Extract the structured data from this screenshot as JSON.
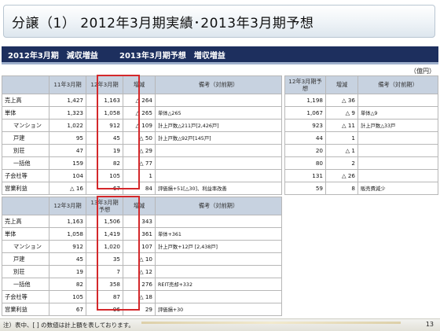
{
  "title": "分譲（1） 2012年3月期実績･2013年3月期予想",
  "section": {
    "left_label": "2012年3月期　減収増益",
    "right_label": "2013年3月期予想　増収増益"
  },
  "unit": "（億円）",
  "tables": {
    "top_left": {
      "headers": [
        "",
        "11年3月期",
        "12年3月期",
        "増減",
        "備考（対前期）"
      ],
      "rows": [
        [
          "売上高",
          "1,427",
          "1,163",
          "△ 264",
          ""
        ],
        [
          "単体",
          "1,323",
          "1,058",
          "△ 265",
          "単体△265"
        ],
        [
          "マンション",
          "1,022",
          "912",
          "△ 109",
          "計上戸数△211戸[2,426戸]"
        ],
        [
          "戸建",
          "95",
          "45",
          "△ 50",
          "計上戸数△92戸[145戸]"
        ],
        [
          "別荘",
          "47",
          "19",
          "△ 29",
          ""
        ],
        [
          "一括他",
          "159",
          "82",
          "△ 77",
          ""
        ],
        [
          "子会社等",
          "104",
          "105",
          "1",
          ""
        ],
        [
          "営業利益",
          "△ 16",
          "67",
          "84",
          "評価損+51[△30]、利益率改善"
        ]
      ]
    },
    "top_right": {
      "headers": [
        "12年3月期予想",
        "増減",
        "備考（対前期）"
      ],
      "rows": [
        [
          "1,198",
          "△ 36",
          ""
        ],
        [
          "1,067",
          "△ 9",
          "単体△9"
        ],
        [
          "923",
          "△ 11",
          "計上戸数△33戸"
        ],
        [
          "44",
          "1",
          ""
        ],
        [
          "20",
          "△ 1",
          ""
        ],
        [
          "80",
          "2",
          ""
        ],
        [
          "131",
          "△ 26",
          ""
        ],
        [
          "59",
          "8",
          "販売費減少"
        ]
      ]
    },
    "bottom_left": {
      "headers": [
        "",
        "12年3月期",
        "13年3月期予想",
        "増減",
        "備考（対前期）"
      ],
      "rows": [
        [
          "売上高",
          "1,163",
          "1,506",
          "343",
          ""
        ],
        [
          "単体",
          "1,058",
          "1,419",
          "361",
          "単体+361"
        ],
        [
          "マンション",
          "912",
          "1,020",
          "107",
          "計上戸数+12戸 [2,438戸]"
        ],
        [
          "戸建",
          "45",
          "35",
          "△ 10",
          ""
        ],
        [
          "別荘",
          "19",
          "7",
          "△ 12",
          ""
        ],
        [
          "一括他",
          "82",
          "358",
          "276",
          "REIT売却+332"
        ],
        [
          "子会社等",
          "105",
          "87",
          "△ 18",
          ""
        ],
        [
          "営業利益",
          "67",
          "96",
          "29",
          "評価損+30"
        ]
      ]
    }
  },
  "footer": {
    "note": "注）表中、[ ] の数値は計上額を表しております。",
    "page": "13"
  }
}
